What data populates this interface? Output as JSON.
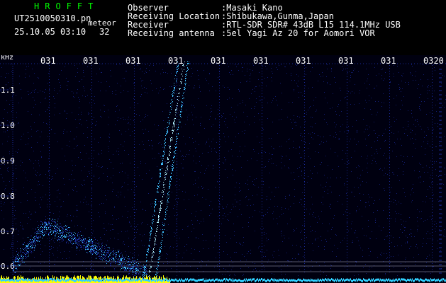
{
  "app": {
    "title": "HROFFT"
  },
  "file": {
    "name": "UT2510050310.pn",
    "tag": "meteor",
    "timestamp": "25.10.05 03:10",
    "count": "32"
  },
  "info": [
    {
      "key": "Observer",
      "value": ":Masaki Kano"
    },
    {
      "key": "Receiving Location",
      "value": ":Shibukawa,Gunma,Japan"
    },
    {
      "key": "Receiver",
      "value": ":RTL-SDR SDR# 43dB L15 114.1MHz USB"
    },
    {
      "key": "Receiving antenna",
      "value": ":5el Yagi Az 20 for Aomori VOR"
    }
  ],
  "spectrogram": {
    "unit_label": "kHz",
    "y_ticks": [
      "1.1",
      "1.0",
      "0.9",
      "0.8",
      "0.7",
      "0.6"
    ],
    "time_labels": [
      "031",
      "031",
      "031",
      "031",
      "031",
      "031",
      "031",
      "031",
      "031",
      "0320"
    ],
    "colors": {
      "background": "#000010",
      "noise": "#1a2a9a",
      "signal": "#40c0ff",
      "bright": "#b0f0ff",
      "baseline": "#ffff00",
      "guide": "#b0b0c8"
    }
  }
}
